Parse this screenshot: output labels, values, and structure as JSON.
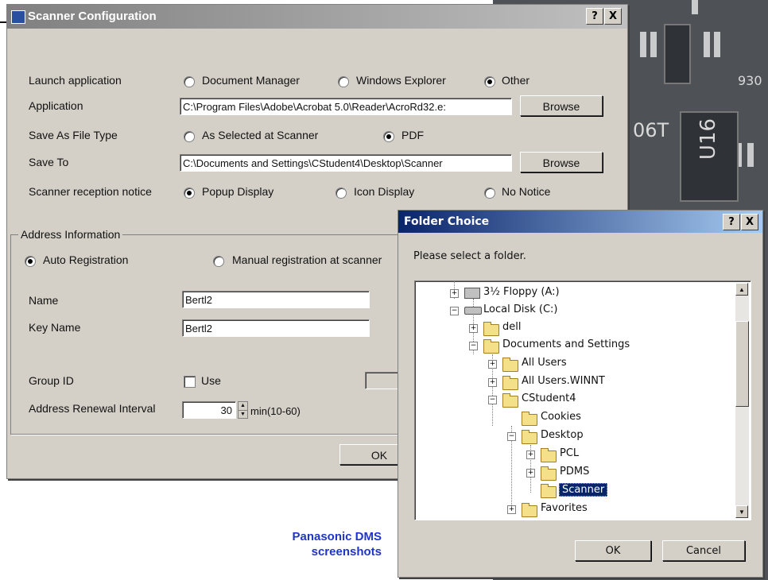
{
  "scanner_config": {
    "title": "Scanner Configuration",
    "title_buttons": {
      "help": "?",
      "close": "X"
    },
    "launch": {
      "label": "Launch application",
      "options": [
        "Document Manager",
        "Windows Explorer",
        "Other"
      ],
      "selected": "Other"
    },
    "application": {
      "label": "Application",
      "value": "C:\\Program Files\\Adobe\\Acrobat 5.0\\Reader\\AcroRd32.e:",
      "browse": "Browse"
    },
    "save_as": {
      "label": "Save As File Type",
      "options": [
        "As Selected at Scanner",
        "PDF"
      ],
      "selected": "PDF"
    },
    "save_to": {
      "label": "Save To",
      "value": "C:\\Documents and Settings\\CStudent4\\Desktop\\Scanner",
      "browse": "Browse"
    },
    "notice": {
      "label": "Scanner reception notice",
      "options": [
        "Popup Display",
        "Icon Display",
        "No Notice"
      ],
      "selected": "Popup Display"
    },
    "address": {
      "group_label": "Address Information",
      "registration_options": [
        "Auto Registration",
        "Manual registration at scanner"
      ],
      "registration_selected": "Auto Registration",
      "name_label": "Name",
      "name_value": "Bertl2",
      "key_label": "Key Name",
      "key_value": "Bertl2",
      "group_id_label": "Group ID",
      "use_label": "Use",
      "use_checked": false,
      "renewal_label": "Address Renewal Interval",
      "renewal_value": "30",
      "renewal_unit": "min(10-60)"
    },
    "ok": "OK"
  },
  "folder_choice": {
    "title": "Folder Choice",
    "title_buttons": {
      "help": "?",
      "close": "X"
    },
    "prompt": "Please select a folder.",
    "tree": [
      {
        "label": "3½ Floppy (A:)",
        "icon": "floppy-drive-icon"
      },
      {
        "label": "Local Disk (C:)",
        "icon": "hard-disk-icon"
      },
      {
        "label": "dell",
        "icon": "folder-icon"
      },
      {
        "label": "Documents and Settings",
        "icon": "folder-icon"
      },
      {
        "label": "All Users",
        "icon": "folder-icon"
      },
      {
        "label": "All Users.WINNT",
        "icon": "folder-icon"
      },
      {
        "label": "CStudent4",
        "icon": "folder-icon"
      },
      {
        "label": "Cookies",
        "icon": "folder-icon"
      },
      {
        "label": "Desktop",
        "icon": "folder-icon"
      },
      {
        "label": "PCL",
        "icon": "folder-icon"
      },
      {
        "label": "PDMS",
        "icon": "folder-icon"
      },
      {
        "label": "Scanner",
        "icon": "open-folder-icon",
        "selected": true
      },
      {
        "label": "Favorites",
        "icon": "favorites-folder-icon"
      }
    ],
    "ok": "OK",
    "cancel": "Cancel"
  },
  "caption": {
    "line1": "Panasonic DMS",
    "line2": "screenshots",
    "color": "#1f35c8"
  },
  "background": {
    "labels": [
      "930",
      "06T",
      "U16"
    ]
  },
  "colors": {
    "dialog_bg": "#d4d0c8",
    "title_active": "#0a246a",
    "title_inactive": "#808080",
    "selection": "#0a246a"
  }
}
